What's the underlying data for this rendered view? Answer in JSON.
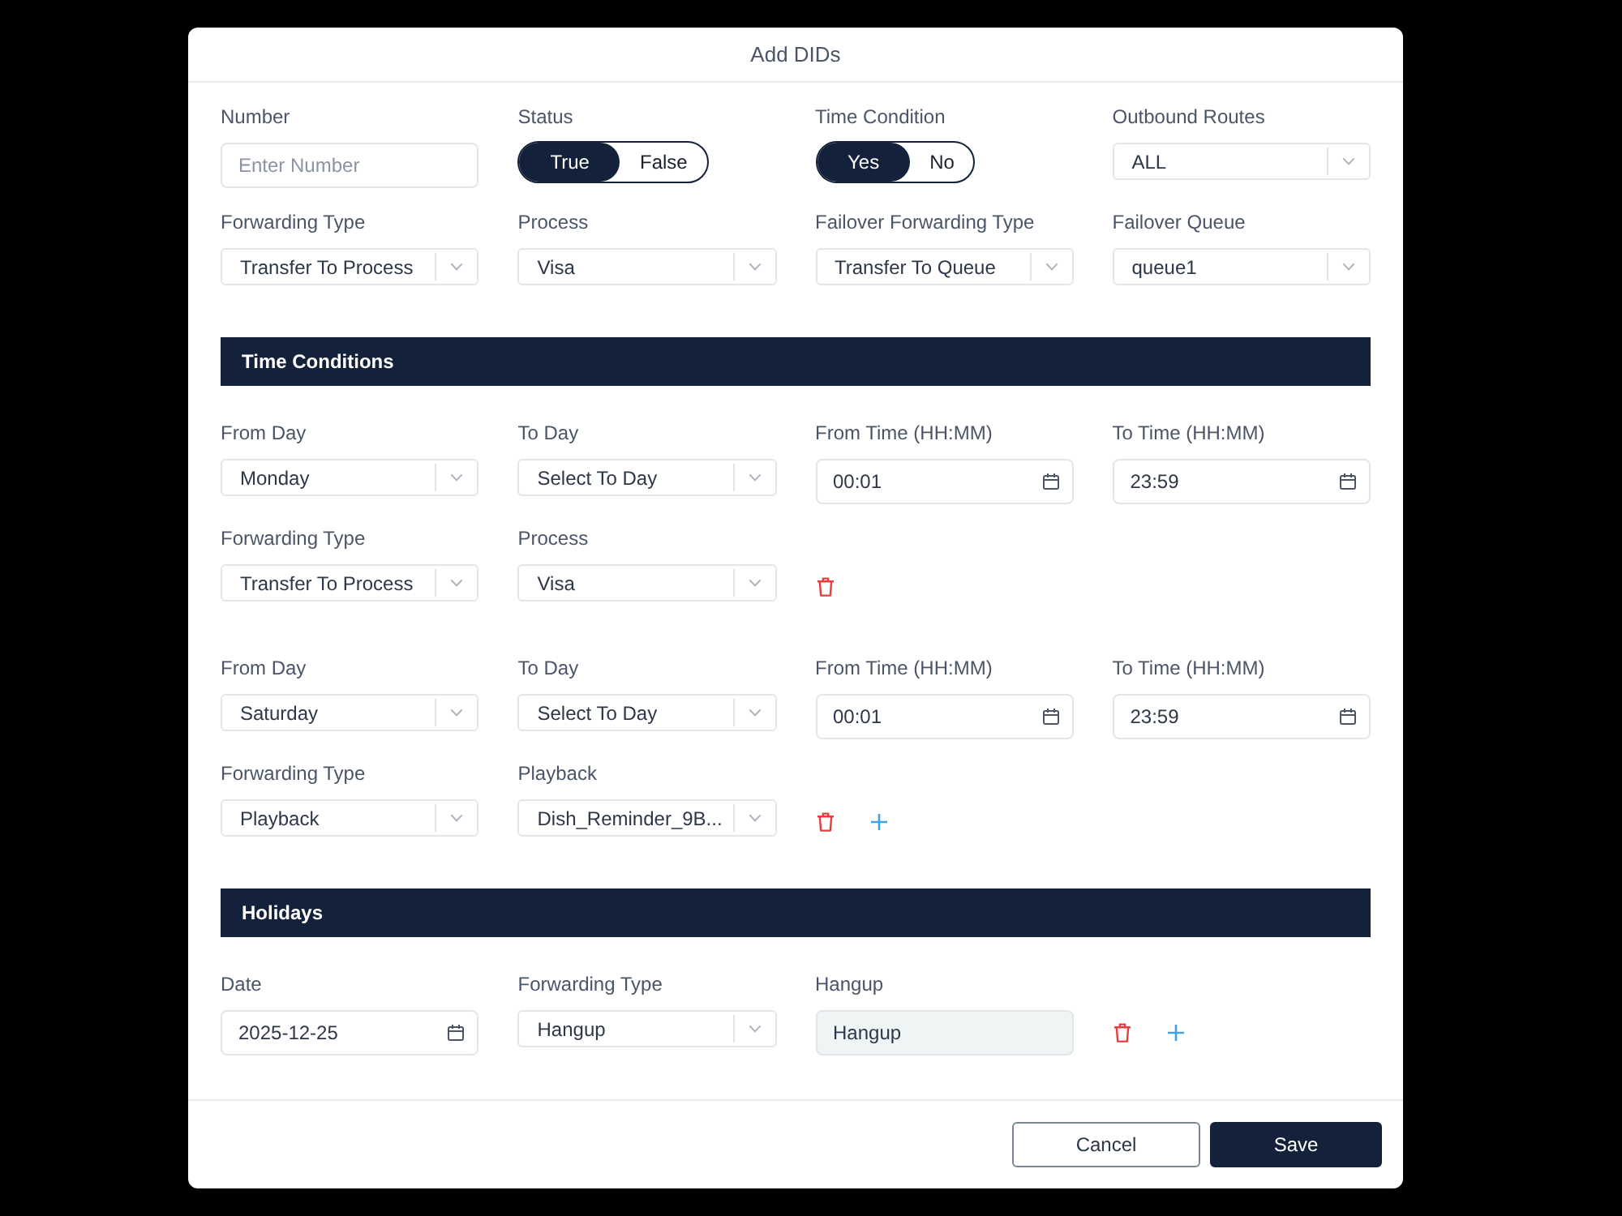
{
  "dialog": {
    "title": "Add DIDs"
  },
  "general_fields": [
    {
      "kind": "text",
      "label": "Number",
      "placeholder": "Enter Number",
      "disabled": false
    },
    {
      "kind": "toggle",
      "label": "Status",
      "options": [
        {
          "label": "True",
          "selected": true
        },
        {
          "label": "False",
          "selected": false
        }
      ]
    },
    {
      "kind": "toggle",
      "label": "Time Condition",
      "options": [
        {
          "label": "Yes",
          "selected": true
        },
        {
          "label": "No",
          "selected": false
        }
      ]
    },
    {
      "kind": "select",
      "label": "Outbound Routes",
      "value": "ALL"
    },
    {
      "kind": "select",
      "label": "Forwarding Type",
      "value": "Transfer To Process"
    },
    {
      "kind": "select",
      "label": "Process",
      "value": "Visa"
    },
    {
      "kind": "select",
      "label": "Failover Forwarding Type",
      "value": "Transfer To Queue"
    },
    {
      "kind": "select",
      "label": "Failover Queue",
      "value": "queue1"
    }
  ],
  "sections": [
    {
      "title": "Time Conditions",
      "rules": [
        {
          "fields": [
            {
              "kind": "select",
              "label": "From Day",
              "value": "Monday"
            },
            {
              "kind": "select",
              "label": "To Day",
              "value": "Select To Day"
            },
            {
              "kind": "time",
              "label": "From Time (HH:MM)",
              "value": "00:01"
            },
            {
              "kind": "time",
              "label": "To Time (HH:MM)",
              "value": "23:59"
            },
            {
              "kind": "select",
              "label": "Forwarding Type",
              "value": "Transfer To Process"
            },
            {
              "kind": "select",
              "label": "Process",
              "value": "Visa"
            }
          ],
          "actions": [
            {
              "kind": "delete"
            }
          ]
        },
        {
          "fields": [
            {
              "kind": "select",
              "label": "From Day",
              "value": "Saturday"
            },
            {
              "kind": "select",
              "label": "To Day",
              "value": "Select To Day"
            },
            {
              "kind": "time",
              "label": "From Time (HH:MM)",
              "value": "00:01"
            },
            {
              "kind": "time",
              "label": "To Time (HH:MM)",
              "value": "23:59"
            },
            {
              "kind": "select",
              "label": "Forwarding Type",
              "value": "Playback"
            },
            {
              "kind": "select",
              "label": "Playback",
              "value": "Dish_Reminder_9B..."
            }
          ],
          "actions": [
            {
              "kind": "delete"
            },
            {
              "kind": "add"
            }
          ]
        }
      ]
    },
    {
      "title": "Holidays",
      "rules": [
        {
          "fields": [
            {
              "kind": "date",
              "label": "Date",
              "value": "2025-12-25"
            },
            {
              "kind": "select",
              "label": "Forwarding Type",
              "value": "Hangup"
            },
            {
              "kind": "text",
              "label": "Hangup",
              "value": "Hangup",
              "disabled": true
            }
          ],
          "actions": [
            {
              "kind": "delete"
            },
            {
              "kind": "add"
            }
          ]
        }
      ]
    }
  ],
  "buttons": [
    {
      "label": "Cancel",
      "kind": "secondary"
    },
    {
      "label": "Save",
      "kind": "primary"
    }
  ]
}
